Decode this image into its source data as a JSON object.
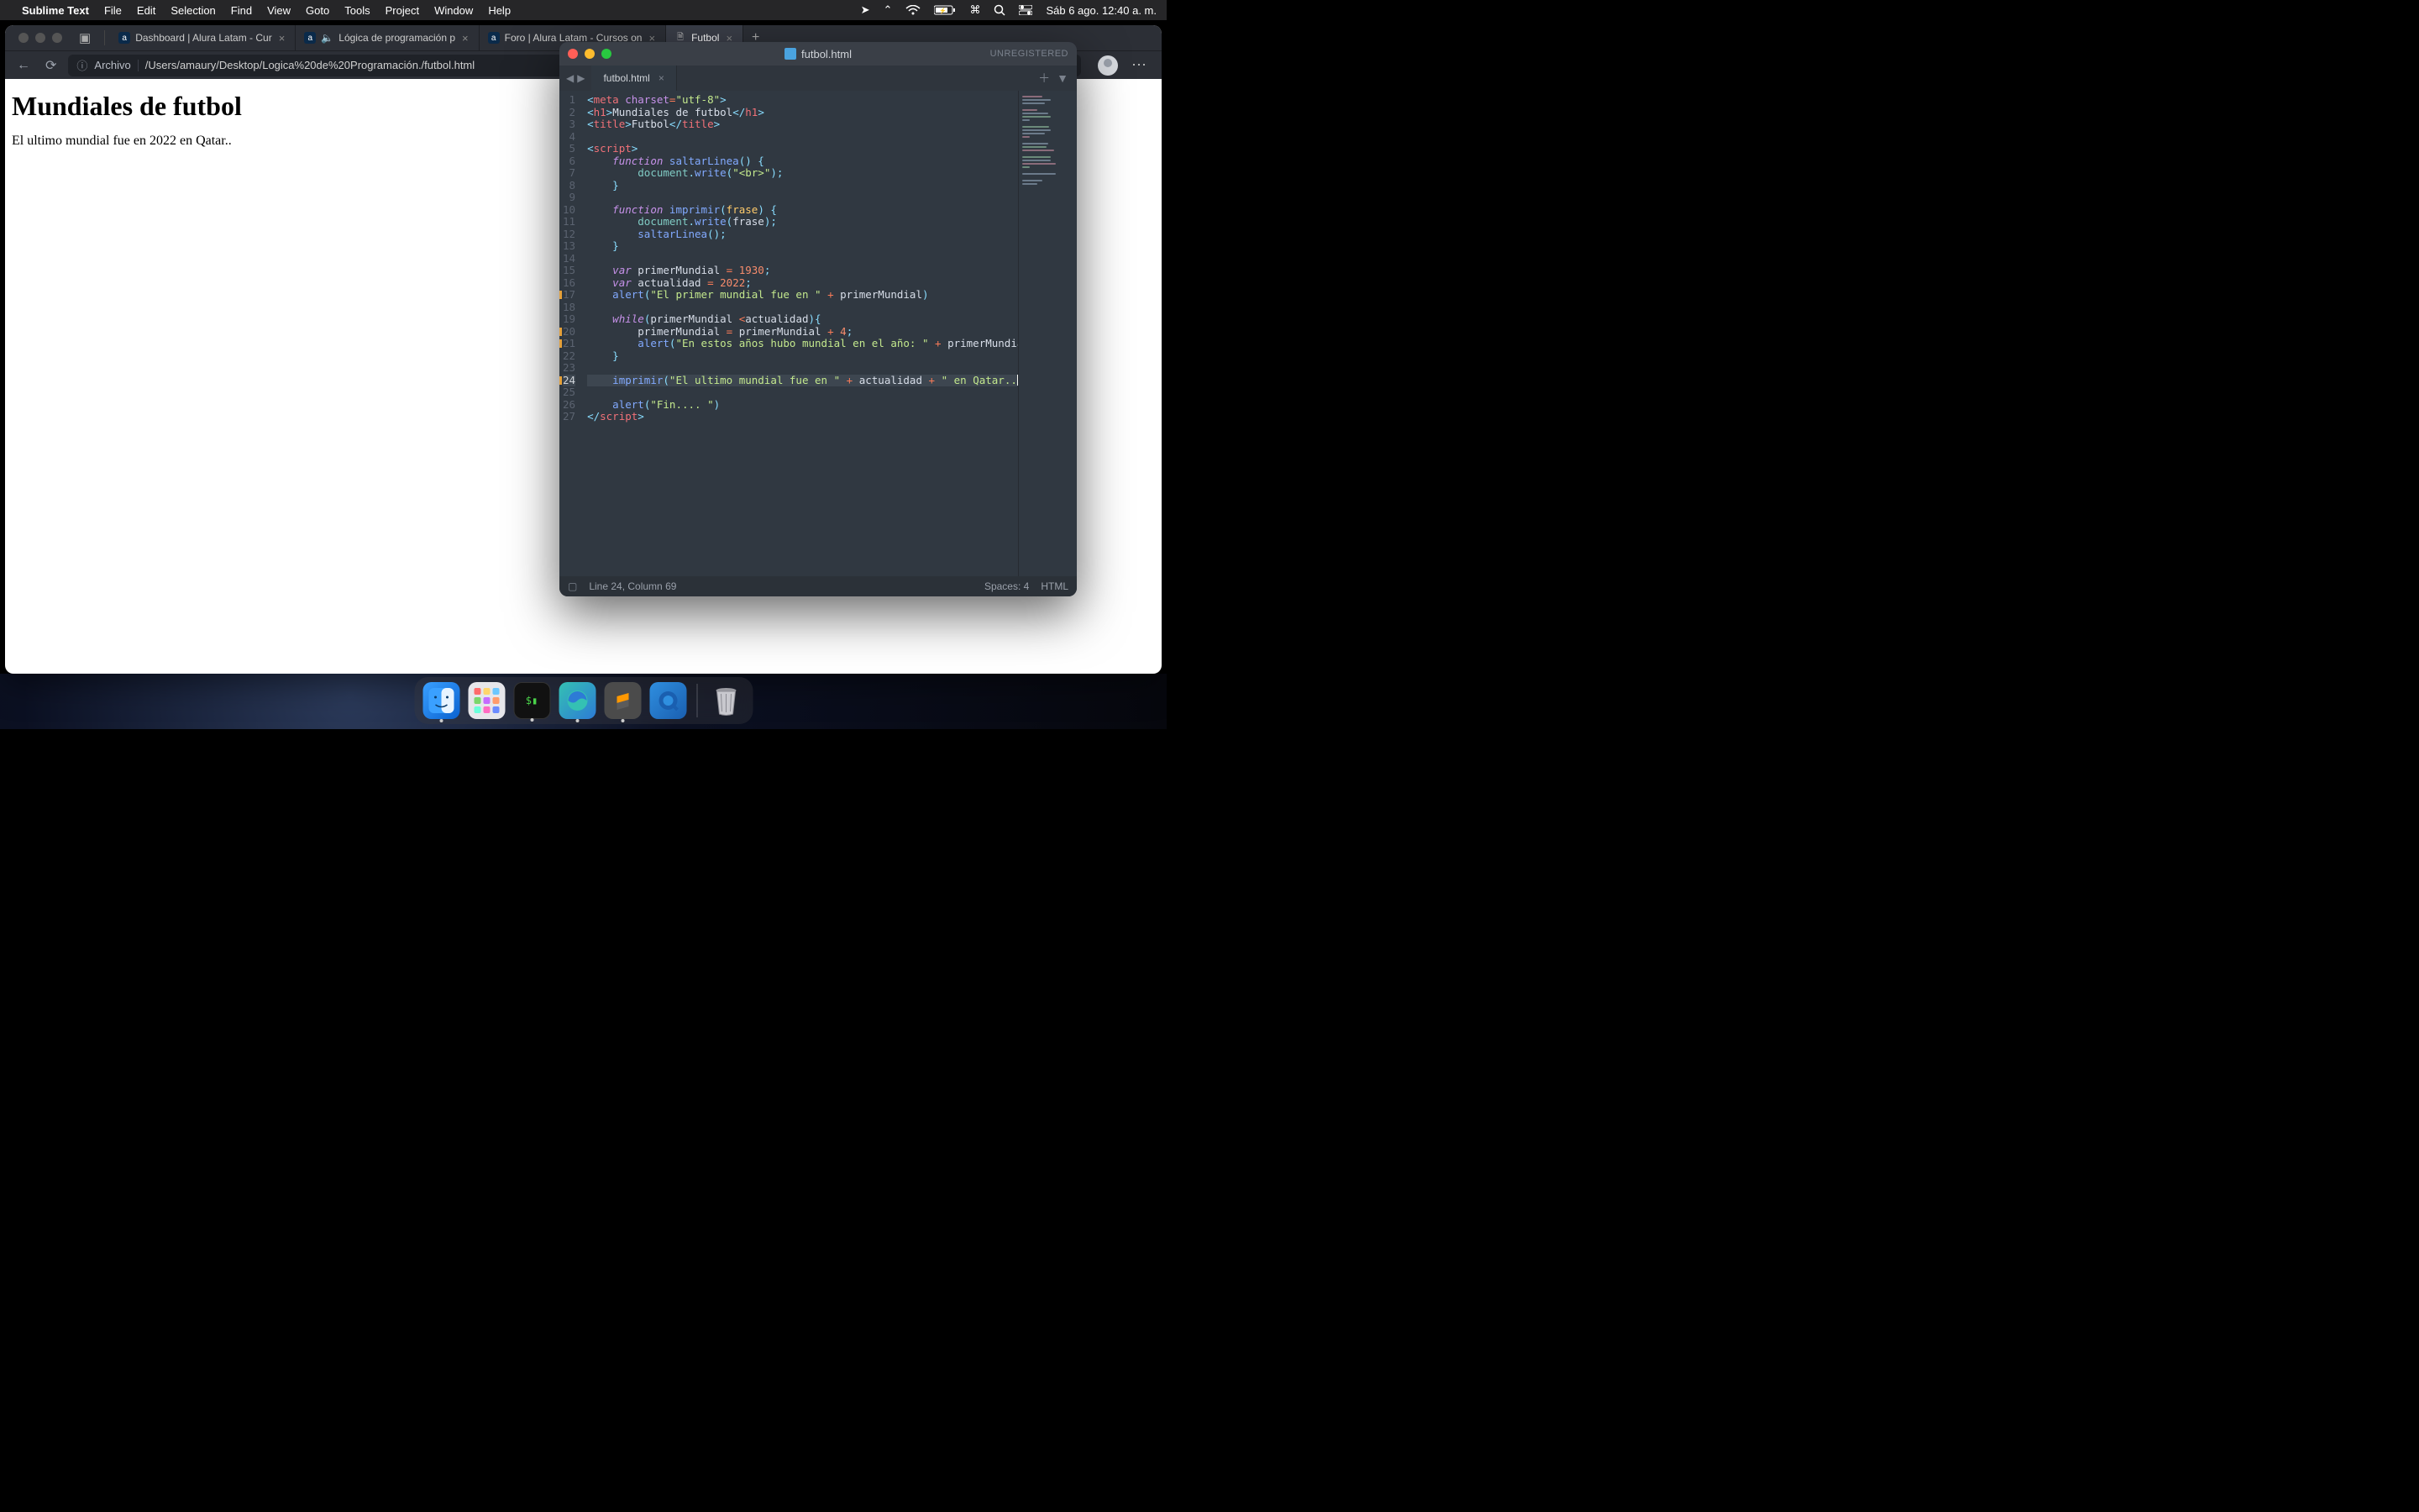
{
  "menubar": {
    "app": "Sublime Text",
    "items": [
      "File",
      "Edit",
      "Selection",
      "Find",
      "View",
      "Goto",
      "Tools",
      "Project",
      "Window",
      "Help"
    ],
    "clock": "Sáb 6 ago.  12:40 a. m."
  },
  "browser": {
    "tabs": [
      {
        "label": "Dashboard | Alura Latam - Cur"
      },
      {
        "label": "Lógica de programación p"
      },
      {
        "label": "Foro | Alura Latam - Cursos on"
      },
      {
        "label": "Futbol"
      }
    ],
    "active_tab": 3,
    "addr_label": "Archivo",
    "url": "/Users/amaury/Desktop/Logica%20de%20Programación./futbol.html",
    "page": {
      "h1": "Mundiales de futbol",
      "p": "El ultimo mundial fue en 2022 en Qatar.."
    }
  },
  "sublime": {
    "title": "futbol.html",
    "unregistered": "UNREGISTERED",
    "tab": "futbol.html",
    "status_left": "Line 24, Column 69",
    "status_spaces": "Spaces: 4",
    "status_lang": "HTML",
    "gutter_marks": [
      17,
      20,
      21,
      24
    ],
    "highlight_line": 24,
    "line_count": 27
  },
  "dock": {
    "apps": [
      "finder",
      "launchpad",
      "terminal",
      "edge",
      "sublime",
      "quicktime"
    ],
    "trash": "trash"
  }
}
